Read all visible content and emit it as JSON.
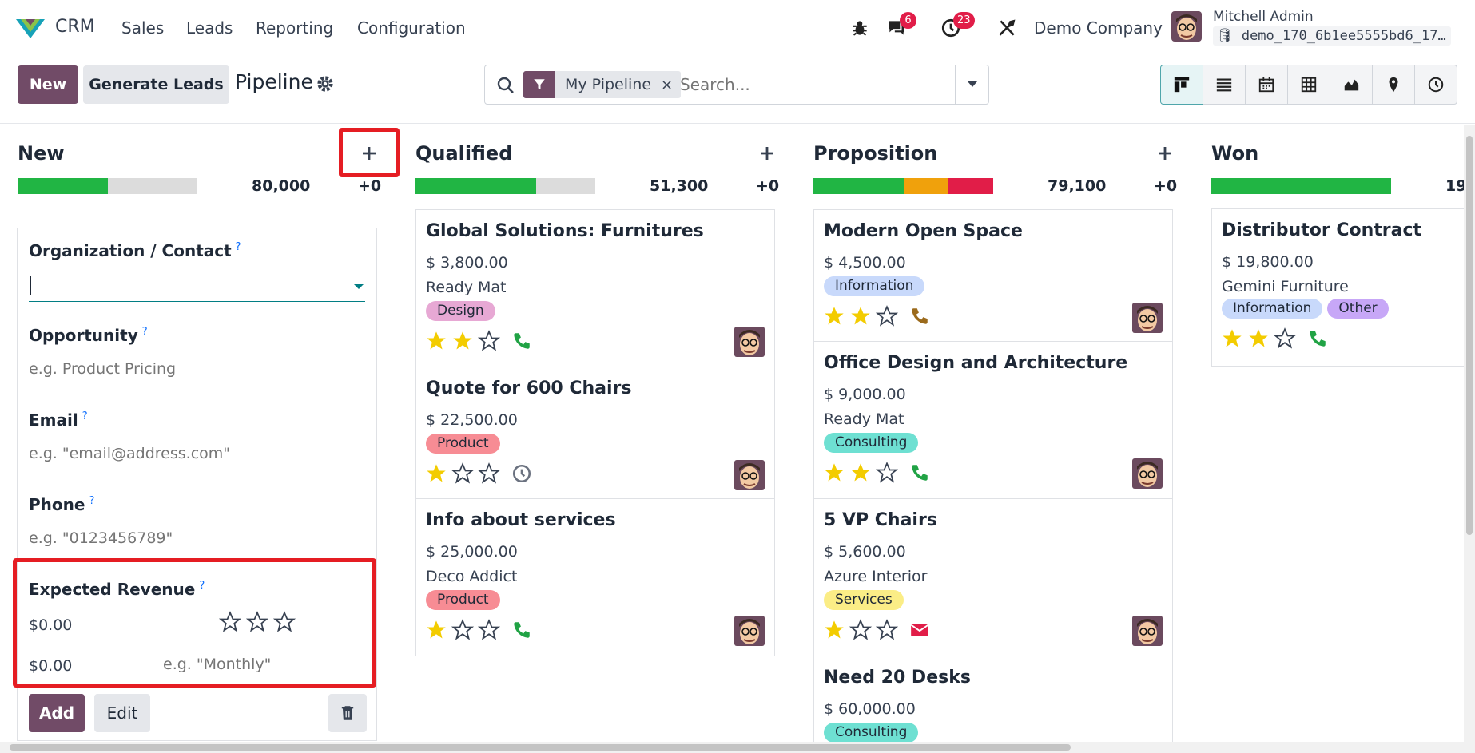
{
  "app": {
    "name": "CRM"
  },
  "nav": {
    "menus": [
      "Sales",
      "Leads",
      "Reporting",
      "Configuration"
    ]
  },
  "systray": {
    "messages_count": "6",
    "activities_count": "23",
    "company": "Demo Company",
    "user": "Mitchell Admin",
    "database": "demo_170_6b1ee5555bd6_17…"
  },
  "control": {
    "new_label": "New",
    "generate_label": "Generate Leads",
    "breadcrumb": "Pipeline",
    "search_facet": "My Pipeline",
    "search_facet_remove": "×",
    "search_placeholder": "Search...",
    "views": [
      "kanban-icon",
      "list-icon",
      "calendar-icon",
      "pivot-icon",
      "graph-icon",
      "map-icon",
      "activity-icon"
    ]
  },
  "columns": [
    {
      "name": "New",
      "sum": "80,000",
      "plus": "+0",
      "progress": {
        "green": 0.5
      }
    },
    {
      "name": "Qualified",
      "sum": "51,300",
      "plus": "+0",
      "progress": {
        "green": 0.67
      }
    },
    {
      "name": "Proposition",
      "sum": "79,100",
      "plus": "+0",
      "progress": {
        "green": 0.5,
        "orange": 0.25,
        "red": 0.25
      }
    },
    {
      "name": "Won",
      "sum": "19",
      "plus": "",
      "progress": {
        "green": 1.0
      }
    }
  ],
  "quick_create": {
    "org_label": "Organization / Contact",
    "help": "?",
    "opportunity_label": "Opportunity",
    "opportunity_placeholder": "e.g. Product Pricing",
    "email_label": "Email",
    "email_placeholder": "e.g. \"email@address.com\"",
    "phone_label": "Phone",
    "phone_placeholder": "e.g. \"0123456789\"",
    "revenue_label": "Expected Revenue",
    "revenue_value": "$0.00",
    "recurring_value": "$0.00",
    "recurring_placeholder": "e.g. \"Monthly\"",
    "priority_stars": 0,
    "add_label": "Add",
    "edit_label": "Edit"
  },
  "cards": {
    "qualified": [
      {
        "title": "Global Solutions: Furnitures",
        "amount": "$ 3,800.00",
        "customer": "Ready Mat",
        "tags": [
          "Design"
        ],
        "stars": 2,
        "activity": "phone"
      },
      {
        "title": "Quote for 600 Chairs",
        "amount": "$ 22,500.00",
        "customer": "",
        "tags": [
          "Product"
        ],
        "stars": 1,
        "activity": "clock"
      },
      {
        "title": "Info about services",
        "amount": "$ 25,000.00",
        "customer": "Deco Addict",
        "tags": [
          "Product"
        ],
        "stars": 1,
        "activity": "phone"
      }
    ],
    "proposition": [
      {
        "title": "Modern Open Space",
        "amount": "$ 4,500.00",
        "customer": "",
        "tags": [
          "Information"
        ],
        "stars": 2,
        "activity": "phone-warning"
      },
      {
        "title": "Office Design and Architecture",
        "amount": "$ 9,000.00",
        "customer": "Ready Mat",
        "tags": [
          "Consulting"
        ],
        "stars": 2,
        "activity": "phone"
      },
      {
        "title": "5 VP Chairs",
        "amount": "$ 5,600.00",
        "customer": "Azure Interior",
        "tags": [
          "Services"
        ],
        "stars": 1,
        "activity": "email"
      },
      {
        "title": "Need 20 Desks",
        "amount": "$ 60,000.00",
        "customer": "",
        "tags": [
          "Consulting"
        ],
        "stars": 0,
        "activity": ""
      }
    ],
    "won": [
      {
        "title": "Distributor Contract",
        "amount": "$ 19,800.00",
        "customer": "Gemini Furniture",
        "tags": [
          "Information",
          "Other"
        ],
        "stars": 2,
        "activity": "phone"
      }
    ]
  },
  "colors": {
    "brand": "#714b67",
    "teal": "#017e84",
    "green": "#21b544",
    "orange": "#f0a10c",
    "red": "#e11d48",
    "highlight": "#e51d23",
    "tag_design": "#e7a8d4",
    "tag_product": "#f78c94",
    "tag_information": "#c8d9fb",
    "tag_consulting": "#6ee0d2",
    "tag_services": "#fbed86",
    "tag_other": "#c7a7f7"
  }
}
